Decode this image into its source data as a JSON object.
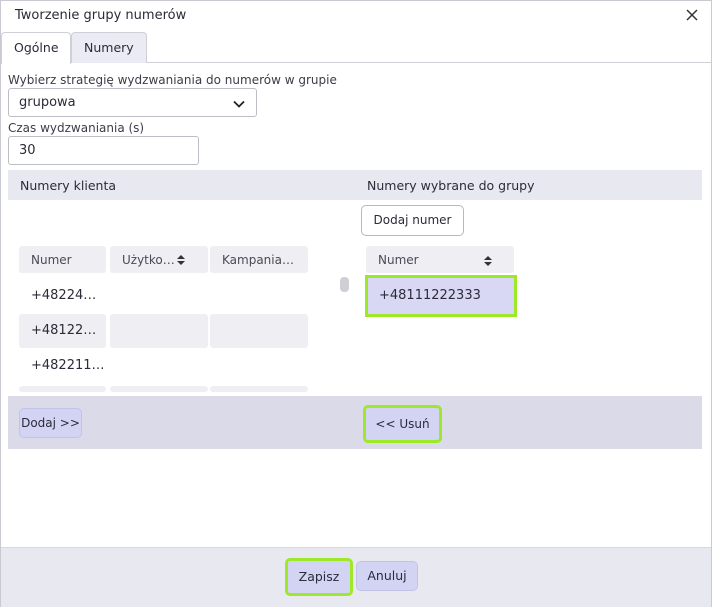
{
  "dialog": {
    "title": "Tworzenie grupy numerów"
  },
  "tabs": [
    {
      "label": "Ogólne"
    },
    {
      "label": "Numery"
    }
  ],
  "form": {
    "strategy_label": "Wybierz strategię wydzwaniania do numerów w grupie",
    "strategy_value": "grupowa",
    "time_label": "Czas wydzwaniania (s)",
    "time_value": "30"
  },
  "left_panel": {
    "title": "Numery klienta",
    "columns": [
      "Numer",
      "Użytko…",
      "Kampania…"
    ],
    "rows": [
      {
        "number": "+48224…",
        "user": "",
        "campaign": ""
      },
      {
        "number": "+48122…",
        "user": "",
        "campaign": ""
      },
      {
        "number": "+482211…",
        "user": "",
        "campaign": ""
      }
    ],
    "add_button": "Dodaj >>"
  },
  "right_panel": {
    "title": "Numery wybrane do grupy",
    "add_number_button": "Dodaj numer",
    "column": "Numer",
    "rows": [
      {
        "number": "+48111222333"
      }
    ],
    "remove_button": "<< Usuń"
  },
  "footer": {
    "save_button": "Zapisz",
    "cancel_button": "Anuluj"
  },
  "colors": {
    "highlight": "#9ee82a",
    "button_lavender": "#d3d3f3",
    "header_bg": "#e8e8f1"
  }
}
